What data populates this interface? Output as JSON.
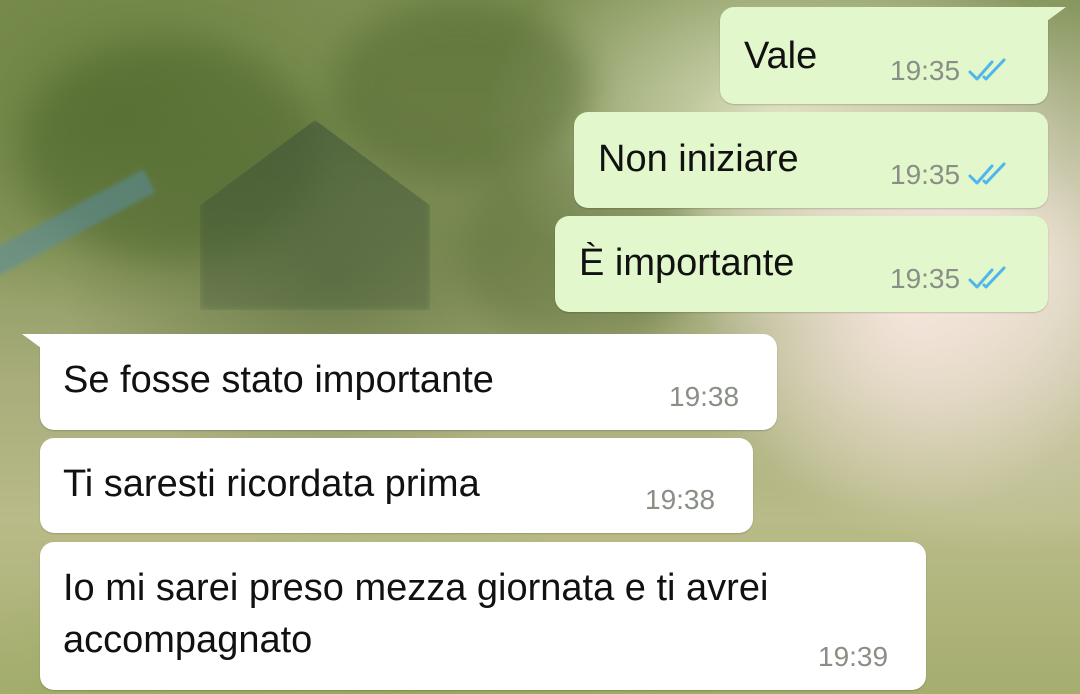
{
  "chat": {
    "messages": [
      {
        "direction": "outgoing",
        "text": "Vale",
        "time": "19:35",
        "status_icon": "double-check-read-icon"
      },
      {
        "direction": "outgoing",
        "text": "Non iniziare",
        "time": "19:35",
        "status_icon": "double-check-read-icon"
      },
      {
        "direction": "outgoing",
        "text": "È importante",
        "time": "19:35",
        "status_icon": "double-check-read-icon"
      },
      {
        "direction": "incoming",
        "text": "Se fosse stato importante",
        "time": "19:38"
      },
      {
        "direction": "incoming",
        "text": "Ti saresti ricordata prima",
        "time": "19:38"
      },
      {
        "direction": "incoming",
        "text": "Io mi sarei preso mezza giornata e ti avrei\naccompagnato",
        "time": "19:39"
      }
    ]
  },
  "colors": {
    "outgoing_bubble": "#e2f7cb",
    "incoming_bubble": "#ffffff",
    "read_ticks": "#4fb6ec",
    "timestamp": "#8a8f86"
  }
}
